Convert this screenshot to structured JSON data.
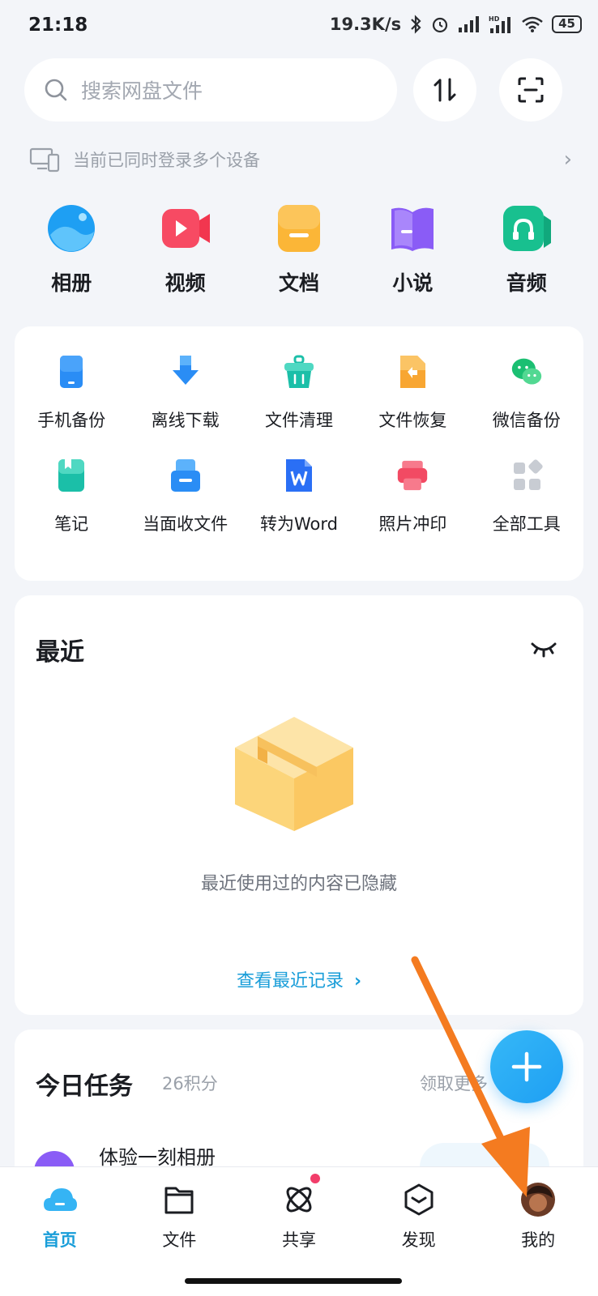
{
  "status_bar": {
    "time": "21:18",
    "network_speed": "19.3K/s",
    "battery": "45",
    "icons": [
      "bluetooth-icon",
      "alarm-icon",
      "signal-icon",
      "signal-hd-icon",
      "wifi-icon",
      "battery-icon"
    ]
  },
  "search": {
    "placeholder": "搜索网盘文件"
  },
  "header_buttons": [
    {
      "icon": "transfer-icon"
    },
    {
      "icon": "scan-icon"
    }
  ],
  "device_notice": {
    "text": "当前已同时登录多个设备"
  },
  "categories": [
    {
      "label": "相册",
      "icon": "album-icon",
      "color": "#1e9ff3"
    },
    {
      "label": "视频",
      "icon": "video-icon",
      "color": "#f74a63"
    },
    {
      "label": "文档",
      "icon": "document-icon",
      "color": "#f8a632"
    },
    {
      "label": "小说",
      "icon": "novel-icon",
      "color": "#8a5cf6"
    },
    {
      "label": "音频",
      "icon": "audio-icon",
      "color": "#18c08f"
    }
  ],
  "tools": [
    {
      "label": "手机备份",
      "icon": "phone-backup-icon",
      "color": "#2a8df5"
    },
    {
      "label": "离线下载",
      "icon": "offline-download-icon",
      "color": "#2a8df5"
    },
    {
      "label": "文件清理",
      "icon": "file-clean-icon",
      "color": "#1bbfa8"
    },
    {
      "label": "文件恢复",
      "icon": "file-restore-icon",
      "color": "#f8a632"
    },
    {
      "label": "微信备份",
      "icon": "wechat-backup-icon",
      "color": "#1bbf72"
    },
    {
      "label": "笔记",
      "icon": "note-icon",
      "color": "#1bbfa8"
    },
    {
      "label": "当面收文件",
      "icon": "receive-file-icon",
      "color": "#2a8df5"
    },
    {
      "label": "转为Word",
      "icon": "word-icon",
      "color": "#2a6ff5"
    },
    {
      "label": "照片冲印",
      "icon": "photo-print-icon",
      "color": "#f24a63"
    },
    {
      "label": "全部工具",
      "icon": "all-tools-icon",
      "color": "#c8ccd3"
    }
  ],
  "recent": {
    "title": "最近",
    "empty_text": "最近使用过的内容已隐藏",
    "link": "查看最近记录",
    "link_chevron": "›"
  },
  "tasks": {
    "title": "今日任务",
    "points": "26积分",
    "more": "领取更多",
    "item_title": "体验一刻相册"
  },
  "fab": {
    "icon": "plus-icon"
  },
  "bottom_nav": [
    {
      "label": "首页",
      "icon": "home-cloud-icon",
      "active": true
    },
    {
      "label": "文件",
      "icon": "folder-icon",
      "active": false
    },
    {
      "label": "共享",
      "icon": "share-icon",
      "active": false,
      "badge": true
    },
    {
      "label": "发现",
      "icon": "discover-icon",
      "active": false
    },
    {
      "label": "我的",
      "icon": "profile-avatar-icon",
      "active": false
    }
  ],
  "colors": {
    "accent": "#1a9ed9",
    "background": "#f3f5f9",
    "annotation_arrow": "#f47b20"
  }
}
